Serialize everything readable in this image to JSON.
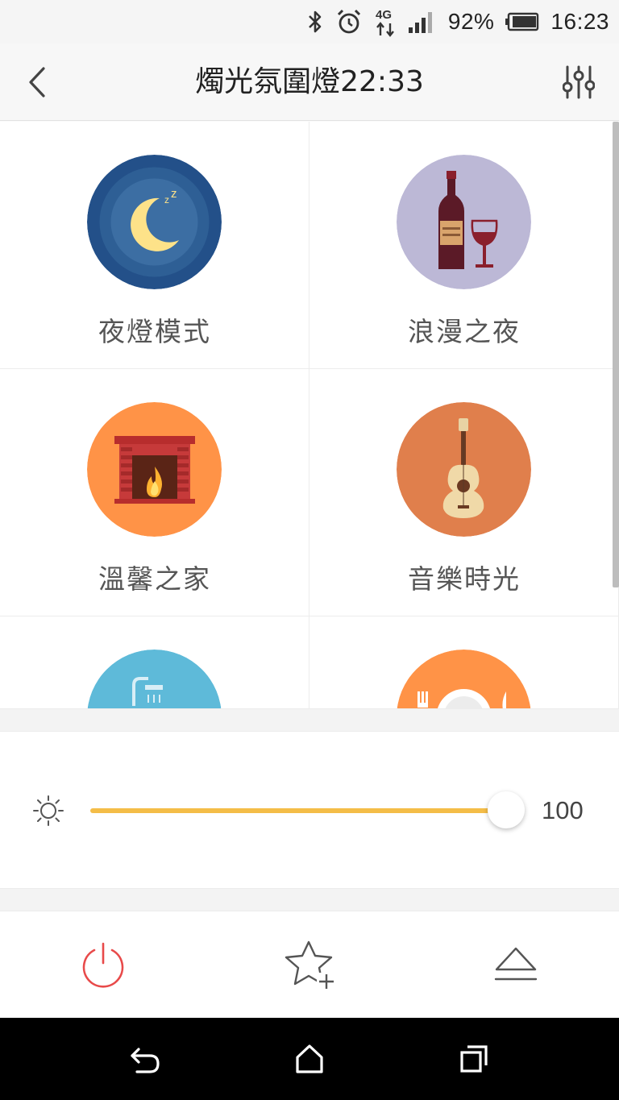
{
  "status_bar": {
    "battery": "92%",
    "time": "16:23",
    "icons": [
      "bluetooth-icon",
      "alarm-icon",
      "4g-icon",
      "signal-icon",
      "battery-icon"
    ]
  },
  "header": {
    "title": "燭光氛圍燈22:33",
    "back_icon": "chevron-left-icon",
    "settings_icon": "sliders-icon"
  },
  "scenes": [
    {
      "label": "夜燈模式",
      "icon": "moon-icon",
      "color": "#2a5a8c"
    },
    {
      "label": "浪漫之夜",
      "icon": "wine-icon",
      "color": "#b8b4d4"
    },
    {
      "label": "溫馨之家",
      "icon": "fireplace-icon",
      "color": "#ff9040"
    },
    {
      "label": "音樂時光",
      "icon": "guitar-icon",
      "color": "#e0804a"
    },
    {
      "label": "",
      "icon": "shower-icon",
      "color": "#5bbad8"
    },
    {
      "label": "",
      "icon": "dining-icon",
      "color": "#ff9040"
    }
  ],
  "brightness": {
    "value": "100",
    "level": 1.0,
    "accent": "#f4bd48",
    "icon": "sun-icon"
  },
  "toolbar": {
    "power_icon": "power-icon",
    "power_color": "#e84a4a",
    "favorite_icon": "star-plus-icon",
    "eject_icon": "eject-icon"
  },
  "nav": {
    "back_icon": "back-icon",
    "home_icon": "home-icon",
    "recent_icon": "recent-apps-icon"
  }
}
